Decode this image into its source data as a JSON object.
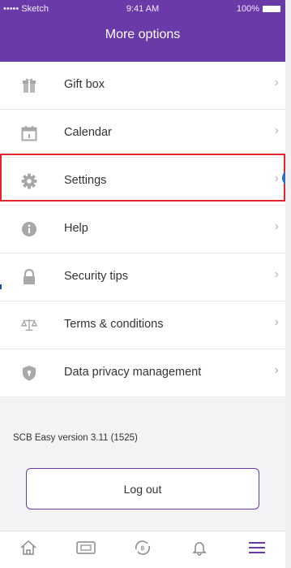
{
  "status_bar": {
    "carrier": "••••• Sketch",
    "time": "9:41 AM",
    "battery": "100%"
  },
  "header": {
    "title": "More options"
  },
  "menu": [
    {
      "label": "Gift box",
      "icon": "gift-icon"
    },
    {
      "label": "Calendar",
      "icon": "calendar-icon"
    },
    {
      "label": "Settings",
      "icon": "gear-icon"
    },
    {
      "label": "Help",
      "icon": "info-icon"
    },
    {
      "label": "Security tips",
      "icon": "lock-icon"
    },
    {
      "label": "Terms & conditions",
      "icon": "scale-icon"
    },
    {
      "label": "Data privacy management",
      "icon": "shield-icon"
    }
  ],
  "version_text": "SCB Easy version 3.11 (1525)",
  "logout_label": "Log out",
  "tabbar": [
    {
      "icon": "home-icon"
    },
    {
      "icon": "card-icon"
    },
    {
      "icon": "transfer-icon"
    },
    {
      "icon": "bell-icon"
    },
    {
      "icon": "menu-icon"
    }
  ],
  "colors": {
    "brand": "#6a3aa8",
    "highlight": "#e3262e"
  }
}
